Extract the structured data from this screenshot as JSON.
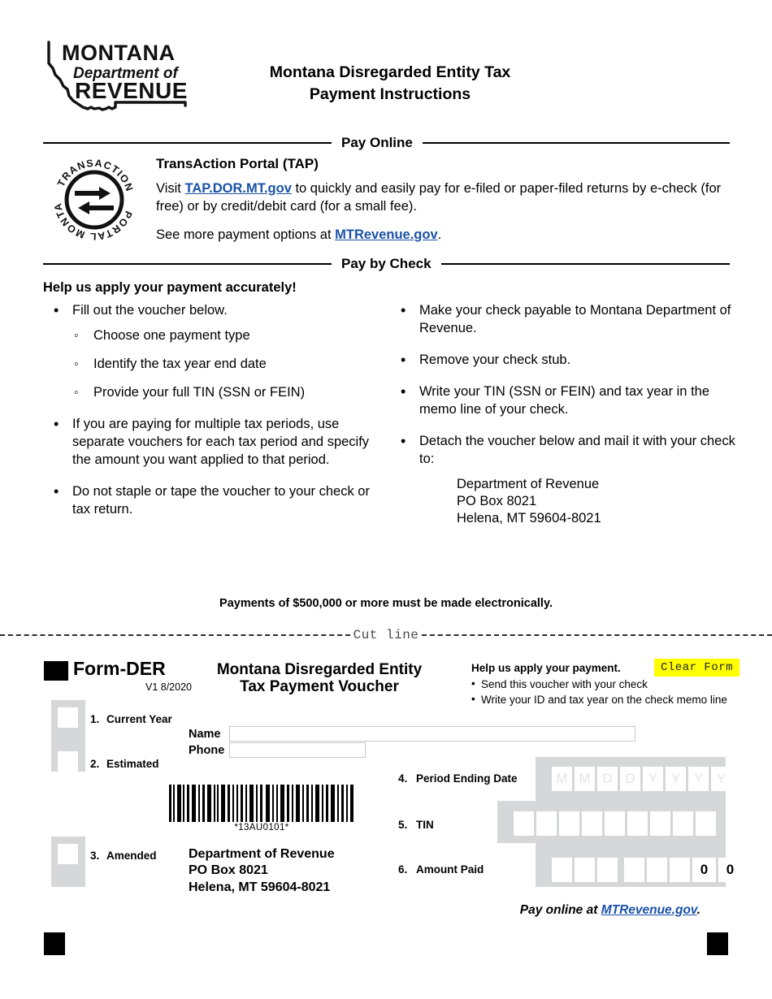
{
  "header": {
    "logo": {
      "line1": "MONTANA",
      "line2": "Department of",
      "line3": "REVENUE"
    },
    "title_line1": "Montana Disregarded Entity Tax",
    "title_line2": "Payment Instructions"
  },
  "pay_online": {
    "section_label": "Pay Online",
    "tap_logo_text": "MONTANA TRANSACTION PORTAL",
    "tap_title": "TransAction Portal (TAP)",
    "para1_before": "Visit ",
    "para1_link": "TAP.DOR.MT.gov",
    "para1_after": " to quickly and easily pay for e-filed or paper-filed returns by e-check (for free) or by credit/debit card (for a small fee).",
    "para2_before": "See more payment options at ",
    "para2_link": "MTRevenue.gov",
    "para2_after": "."
  },
  "pay_by_check": {
    "section_label": "Pay by Check",
    "help_heading": "Help us apply your payment accurately!",
    "left_bullets": [
      {
        "text": "Fill out the voucher below.",
        "sub": [
          "Choose one payment type",
          "Identify the tax year end date",
          "Provide your full TIN (SSN or FEIN)"
        ]
      },
      {
        "text": "If you are paying for multiple tax periods, use separate vouchers for each tax period and specify the amount you want applied to that period.",
        "sub": []
      },
      {
        "text": "Do not staple or tape the voucher to your check or tax return.",
        "sub": []
      }
    ],
    "right_bullets": [
      {
        "text": "Make your check payable to Montana Department of Revenue.",
        "address": []
      },
      {
        "text": "Remove your check stub.",
        "address": []
      },
      {
        "text": "Write your TIN (SSN or FEIN) and tax year in the memo line of your check.",
        "address": []
      },
      {
        "text": "Detach the voucher below and mail it with your check to:",
        "address": [
          "Department of Revenue",
          "PO Box 8021",
          "Helena, MT 59604-8021"
        ]
      }
    ]
  },
  "notice": "Payments of $500,000 or more must be made electronically.",
  "cut_line_label": "Cut line",
  "voucher": {
    "form_id": "Form-DER",
    "form_version": "V1 8/2020",
    "title_line1": "Montana Disregarded Entity",
    "title_line2": "Tax Payment Voucher",
    "help_heading": "Help us apply your payment.",
    "help_items": [
      "Send this voucher with your check",
      "Write your ID and tax year on the check memo line"
    ],
    "clear_form_label": "Clear Form",
    "payment_types": [
      {
        "number": "1.",
        "label": "Current Year",
        "checked": false
      },
      {
        "number": "2.",
        "label": "Estimated",
        "checked": false
      },
      {
        "number": "3.",
        "label": "Amended",
        "checked": false
      }
    ],
    "name_label": "Name",
    "name_value": "",
    "name_placeholder": "",
    "phone_label": "Phone",
    "phone_value": "",
    "phone_placeholder": "",
    "barcode_text": "*13AU0101*",
    "mail_address": [
      "Department of Revenue",
      "PO Box 8021",
      "Helena, MT 59604-8021"
    ],
    "fields": [
      {
        "number": "4.",
        "label": "Period Ending Date"
      },
      {
        "number": "5.",
        "label": "TIN"
      },
      {
        "number": "6.",
        "label": "Amount Paid"
      }
    ],
    "period_boxes": [
      "M",
      "M",
      "D",
      "D",
      "Y",
      "Y",
      "Y",
      "Y"
    ],
    "tin_boxes": [
      "",
      "",
      "",
      "",
      "",
      "",
      "",
      "",
      ""
    ],
    "amount_boxes": [
      "",
      "",
      "",
      "",
      "",
      ""
    ],
    "amount_cents": [
      "0",
      "0"
    ],
    "footer_before": "Pay online at ",
    "footer_link": "MTRevenue.gov",
    "footer_after": "."
  },
  "colors": {
    "link": "#1a52a8",
    "shade": "#d6d7d8",
    "highlight": "#ffff00",
    "ink": "#000000"
  }
}
